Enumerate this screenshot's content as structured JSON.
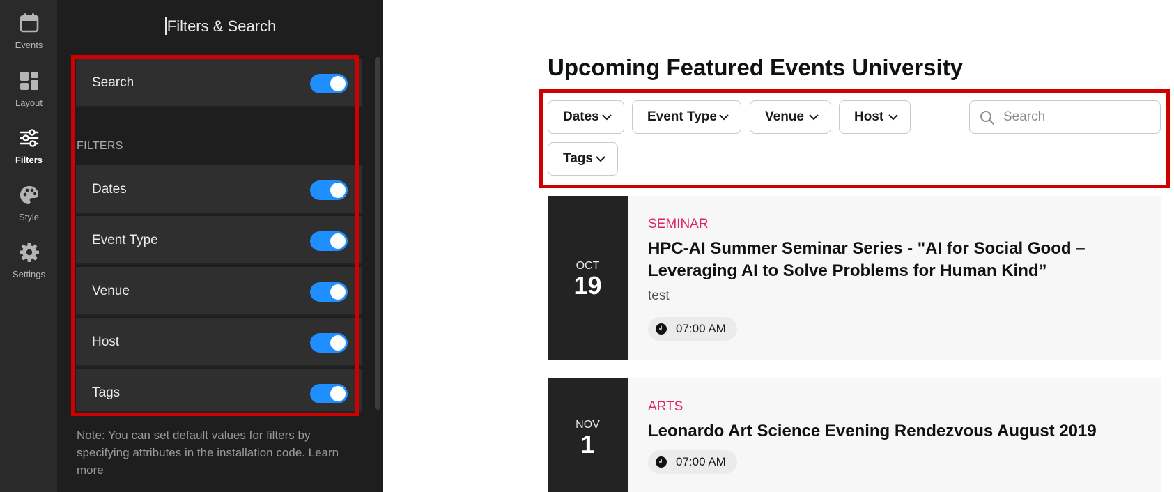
{
  "rail": {
    "items": [
      {
        "label": "Events",
        "icon": "calendar-icon"
      },
      {
        "label": "Layout",
        "icon": "layout-grid-icon"
      },
      {
        "label": "Filters",
        "icon": "sliders-icon"
      },
      {
        "label": "Style",
        "icon": "palette-icon"
      },
      {
        "label": "Settings",
        "icon": "gear-icon"
      }
    ],
    "active": "Filters"
  },
  "panel": {
    "title": "Filters & Search",
    "search_row": {
      "label": "Search",
      "enabled": true
    },
    "filters_heading": "FILTERS",
    "filter_rows": [
      {
        "label": "Dates",
        "enabled": true
      },
      {
        "label": "Event Type",
        "enabled": true
      },
      {
        "label": "Venue",
        "enabled": true
      },
      {
        "label": "Host",
        "enabled": true
      },
      {
        "label": "Tags",
        "enabled": true
      }
    ],
    "note": "Note: You can set default values for filters by specifying attributes in the installation code. Learn more"
  },
  "preview": {
    "title": "Upcoming Featured Events University",
    "filter_buttons": [
      "Dates",
      "Event Type",
      "Venue",
      "Host",
      "Tags"
    ],
    "search_placeholder": "Search",
    "events": [
      {
        "month": "OCT",
        "day": "19",
        "category": "SEMINAR",
        "title": "HPC-AI Summer Seminar Series - \"AI for Social Good – Leveraging AI to Solve Problems for Human Kind”",
        "subtitle": "test",
        "time": "07:00 AM"
      },
      {
        "month": "NOV",
        "day": "1",
        "category": "ARTS",
        "title": "Leonardo Art Science Evening Rendezvous August 2019",
        "subtitle": "",
        "time": "07:00 AM"
      }
    ]
  },
  "colors": {
    "toggle_on": "#1f8fff",
    "highlight": "#d00000",
    "category_accent": "#e0245e",
    "panel_bg": "#1e1e1e",
    "rail_bg": "#2a2a2a"
  }
}
